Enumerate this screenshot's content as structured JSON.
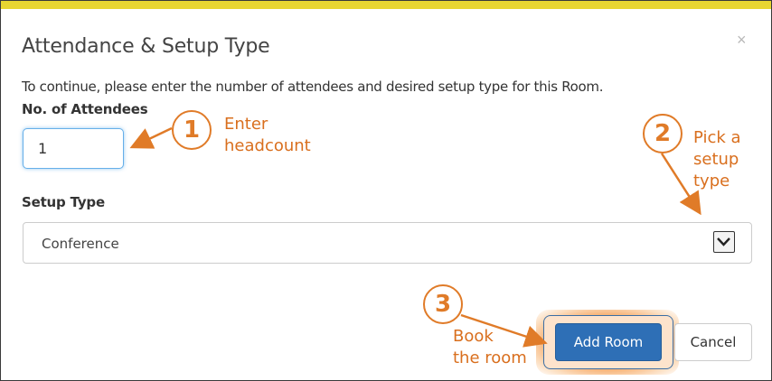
{
  "dialog": {
    "title": "Attendance & Setup Type",
    "close_glyph": "×",
    "instructions": "To continue, please enter the number of attendees and desired setup type for this Room.",
    "attendees": {
      "label": "No. of Attendees",
      "value": "1"
    },
    "setup_type": {
      "label": "Setup Type",
      "selected": "Conference"
    },
    "buttons": {
      "add_room": "Add Room",
      "cancel": "Cancel"
    }
  },
  "annotations": [
    {
      "number": "1",
      "text": [
        "Enter",
        "headcount"
      ]
    },
    {
      "number": "2",
      "text": [
        "Pick a",
        "setup",
        "type"
      ]
    },
    {
      "number": "3",
      "text": [
        "Book",
        "the room"
      ]
    }
  ],
  "colors": {
    "accent_bar": "#e8d631",
    "primary_button": "#2e6fb6",
    "annotation": "#e07b28",
    "focus_ring": "#66afe9"
  },
  "icons": [
    "close-icon",
    "dropdown-arrow-icon"
  ]
}
